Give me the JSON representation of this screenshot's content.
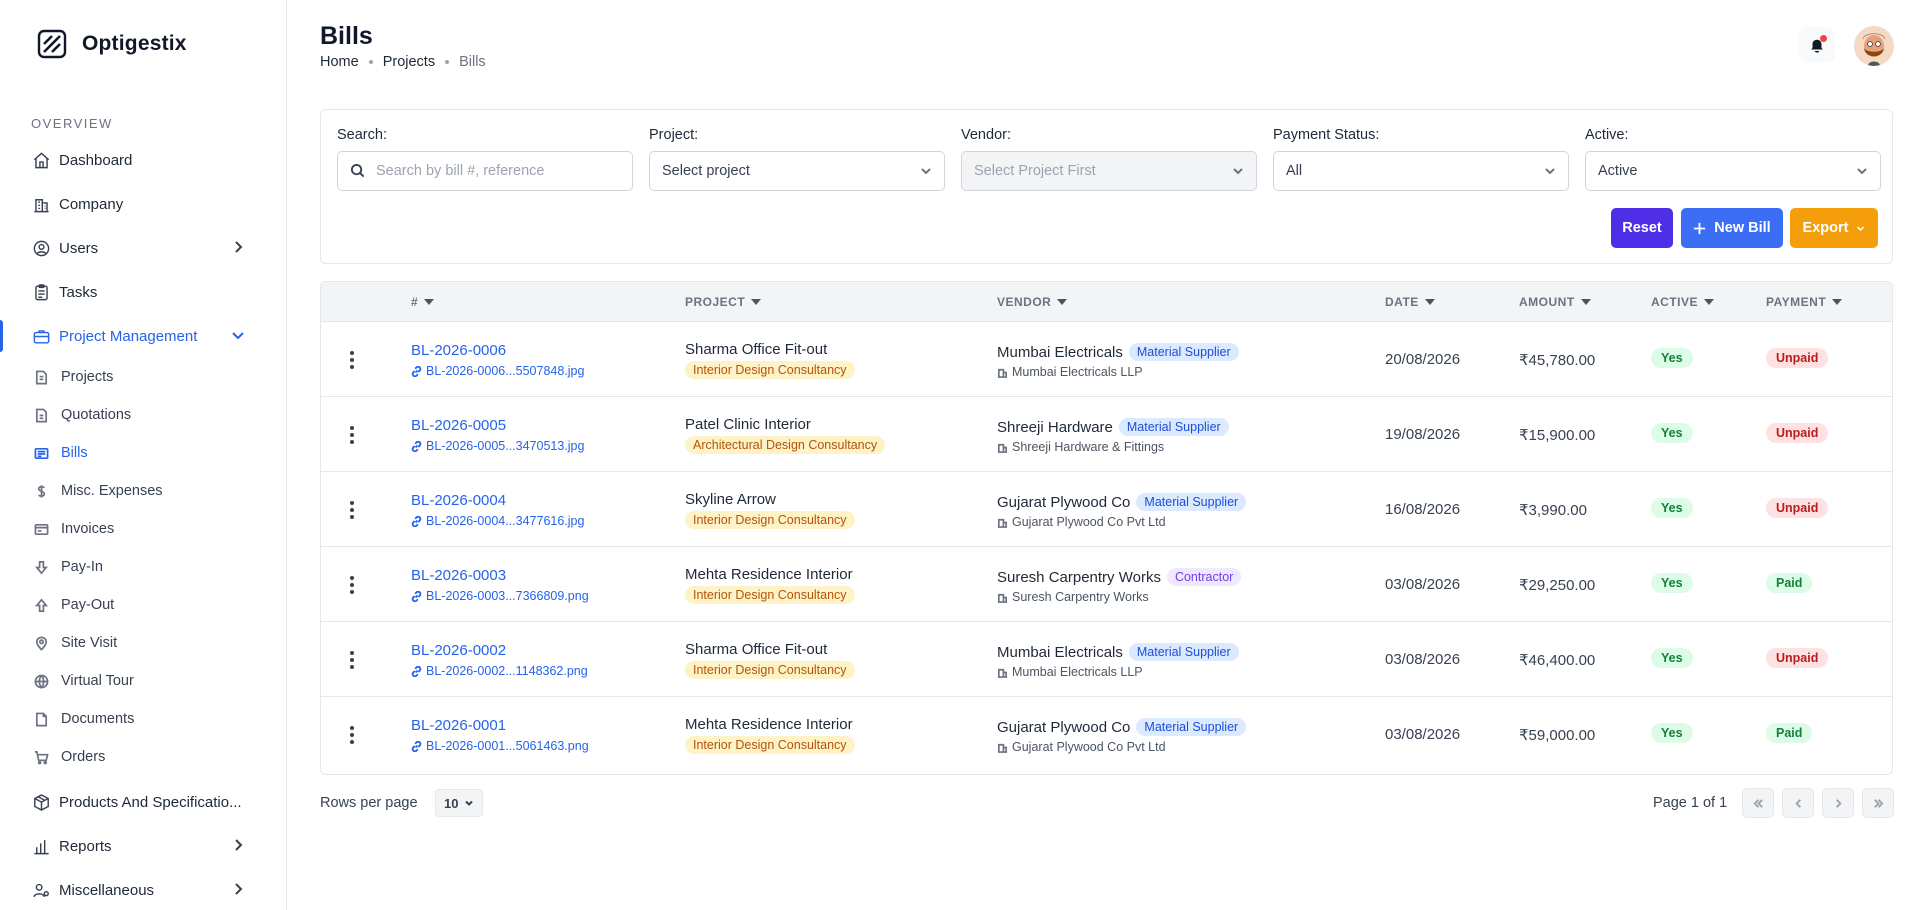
{
  "brand": {
    "name": "Optigestix"
  },
  "sidebar": {
    "section_label": "OVERVIEW",
    "items": [
      {
        "label": "Dashboard",
        "icon": "home-icon"
      },
      {
        "label": "Company",
        "icon": "building-icon"
      },
      {
        "label": "Users",
        "icon": "user-circle-icon"
      },
      {
        "label": "Tasks",
        "icon": "clipboard-icon"
      },
      {
        "label": "Project Management",
        "icon": "briefcase-icon"
      }
    ],
    "sub_items": [
      {
        "label": "Projects",
        "icon": "document-icon"
      },
      {
        "label": "Quotations",
        "icon": "document-icon"
      },
      {
        "label": "Bills",
        "icon": "receipt-icon"
      },
      {
        "label": "Misc. Expenses",
        "icon": "dollar-icon"
      },
      {
        "label": "Invoices",
        "icon": "invoice-icon"
      },
      {
        "label": "Pay-In",
        "icon": "arrow-down-icon"
      },
      {
        "label": "Pay-Out",
        "icon": "arrow-up-icon"
      },
      {
        "label": "Site Visit",
        "icon": "map-pin-icon"
      },
      {
        "label": "Virtual Tour",
        "icon": "globe-icon"
      },
      {
        "label": "Documents",
        "icon": "document-icon"
      },
      {
        "label": "Orders",
        "icon": "cart-icon"
      }
    ],
    "bottom_items": [
      {
        "label": "Products And Specificatio...",
        "icon": "box-icon"
      },
      {
        "label": "Reports",
        "icon": "bar-chart-icon"
      },
      {
        "label": "Miscellaneous",
        "icon": "users-cog-icon"
      }
    ]
  },
  "header": {
    "title": "Bills",
    "breadcrumb": [
      "Home",
      "Projects",
      "Bills"
    ]
  },
  "filters": {
    "search_label": "Search:",
    "search_placeholder": "Search by bill #, reference",
    "project_label": "Project:",
    "project_value": "Select project",
    "vendor_label": "Vendor:",
    "vendor_value": "Select Project First",
    "payment_label": "Payment Status:",
    "payment_value": "All",
    "active_label": "Active:",
    "active_value": "Active",
    "reset_label": "Reset",
    "new_label": "New Bill",
    "export_label": "Export"
  },
  "table": {
    "columns": [
      "#",
      "PROJECT",
      "VENDOR",
      "DATE",
      "AMOUNT",
      "ACTIVE",
      "PAYMENT"
    ],
    "rows": [
      {
        "bill": "BL-2026-0006",
        "file": "BL-2026-0006...5507848.jpg",
        "project": "Sharma Office Fit-out",
        "project_type": "Interior Design Consultancy",
        "vendor": "Mumbai Electricals",
        "vendor_type": "Material Supplier",
        "vendor_legal": "Mumbai Electricals LLP",
        "date": "20/08/2026",
        "amount": "₹45,780.00",
        "active": "Yes",
        "payment": "Unpaid"
      },
      {
        "bill": "BL-2026-0005",
        "file": "BL-2026-0005...3470513.jpg",
        "project": "Patel Clinic Interior",
        "project_type": "Architectural Design Consultancy",
        "vendor": "Shreeji Hardware",
        "vendor_type": "Material Supplier",
        "vendor_legal": "Shreeji Hardware & Fittings",
        "date": "19/08/2026",
        "amount": "₹15,900.00",
        "active": "Yes",
        "payment": "Unpaid"
      },
      {
        "bill": "BL-2026-0004",
        "file": "BL-2026-0004...3477616.jpg",
        "project": "Skyline Arrow",
        "project_type": "Interior Design Consultancy",
        "vendor": "Gujarat Plywood Co",
        "vendor_type": "Material Supplier",
        "vendor_legal": "Gujarat Plywood Co Pvt Ltd",
        "date": "16/08/2026",
        "amount": "₹3,990.00",
        "active": "Yes",
        "payment": "Unpaid"
      },
      {
        "bill": "BL-2026-0003",
        "file": "BL-2026-0003...7366809.png",
        "project": "Mehta Residence Interior",
        "project_type": "Interior Design Consultancy",
        "vendor": "Suresh Carpentry Works",
        "vendor_type": "Contractor",
        "vendor_legal": "Suresh Carpentry Works",
        "date": "03/08/2026",
        "amount": "₹29,250.00",
        "active": "Yes",
        "payment": "Paid"
      },
      {
        "bill": "BL-2026-0002",
        "file": "BL-2026-0002...1148362.png",
        "project": "Sharma Office Fit-out",
        "project_type": "Interior Design Consultancy",
        "vendor": "Mumbai Electricals",
        "vendor_type": "Material Supplier",
        "vendor_legal": "Mumbai Electricals LLP",
        "date": "03/08/2026",
        "amount": "₹46,400.00",
        "active": "Yes",
        "payment": "Unpaid"
      },
      {
        "bill": "BL-2026-0001",
        "file": "BL-2026-0001...5061463.png",
        "project": "Mehta Residence Interior",
        "project_type": "Interior Design Consultancy",
        "vendor": "Gujarat Plywood Co",
        "vendor_type": "Material Supplier",
        "vendor_legal": "Gujarat Plywood Co Pvt Ltd",
        "date": "03/08/2026",
        "amount": "₹59,000.00",
        "active": "Yes",
        "payment": "Paid"
      }
    ]
  },
  "pagination": {
    "rows_label": "Rows per page",
    "rows_value": "10",
    "page_info": "Page 1 of 1"
  },
  "colors": {
    "primary": "#2563eb",
    "reset": "#4f2ee8",
    "new_bill": "#3b6ef5",
    "export": "#f59e0b"
  }
}
